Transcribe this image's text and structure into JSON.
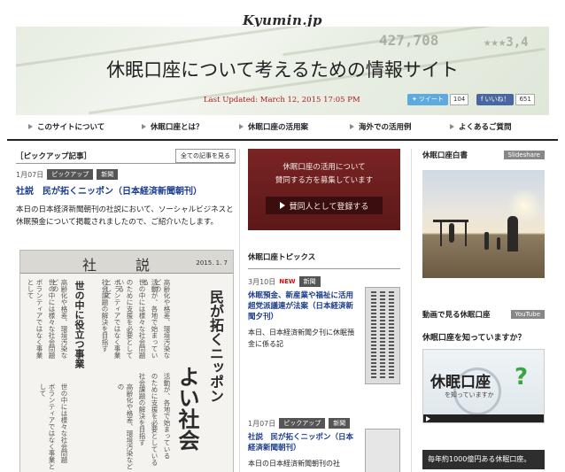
{
  "site": {
    "logo": "Kyumin.jp",
    "title": "休眠口座について考えるための情報サイト",
    "last_updated": "Last Updated: March 12, 2015 17:05 PM",
    "banner_numbers": [
      "427,708",
      "★★★3,4"
    ]
  },
  "share": {
    "tweet_label": "ツイート",
    "tweet_count": "104",
    "like_label": "いいね！",
    "like_count": "651"
  },
  "nav": {
    "items": [
      {
        "label": "このサイトについて"
      },
      {
        "label": "休眠口座とは？"
      },
      {
        "label": "休眠口座の活用案"
      },
      {
        "label": "海外での活用例"
      },
      {
        "label": "よくあるご質問"
      }
    ]
  },
  "pickup": {
    "section_title": "［ピックアップ記事］",
    "see_all": "全ての記事を見る",
    "date": "1月07日",
    "tags": [
      "ピックアップ",
      "新聞"
    ],
    "title": "社説　民が拓くニッポン（日本経済新聞朝刊）",
    "body": "本日の日本経済新聞朝刊の社説において、ソーシャルビジネスと休眠預金について掲載されましたので、ご紹介いたします。",
    "clip": {
      "header": "社　説",
      "date": "2015. 1. 7",
      "headline1": "民が拓くニッポン",
      "headline2": "よい社会",
      "subhead": "世の中に役立つ事業",
      "col1": "高齢化や格差、環境汚染などの",
      "col2": "活動が、各地で始まっている",
      "col3": "世の中には様々な社会問題",
      "col4": "のために支援を必要としている",
      "col5": "ボランティアではなく事業として",
      "col6": "社会課題の解決を目指す"
    }
  },
  "promo": {
    "line1": "休眠口座の活用について",
    "line2": "賛同する方を募集しています",
    "button": "賛同人として登録する"
  },
  "topics": {
    "section_title": "休眠口座トピックス",
    "items": [
      {
        "date": "3月10日",
        "new_label": "NEW",
        "tag": "新聞",
        "title": "休眠預金、新産業や福祉に活用　超党派議連が法案（日本経済新聞夕刊）",
        "body": "本日、日本経済新聞夕刊に休眠預金に係る記"
      },
      {
        "date": "1月07日",
        "tags": [
          "ピックアップ",
          "新聞"
        ],
        "title": "社説　民が拓くニッポン（日本経済新聞朝刊）",
        "body": "本日の日本経済新聞朝刊の社"
      }
    ]
  },
  "right": {
    "white_paper_title": "休眠口座白書",
    "white_paper_tag": "Slideshare",
    "video_section_title": "動画で見る休眠口座",
    "video_tag": "YouTube",
    "know_title": "休眠口座を知っていますか？",
    "video_main": "休眠口座",
    "video_sub": "を知っていますか",
    "video_q": "?",
    "note": "毎年約1000億円ある休眠口座。"
  },
  "colors": {
    "accent_red": "#b01818",
    "link_blue": "#1a3c8c",
    "promo_bg": "#6b1f1f",
    "twitter": "#5ea9dd",
    "facebook": "#4a66a0"
  }
}
